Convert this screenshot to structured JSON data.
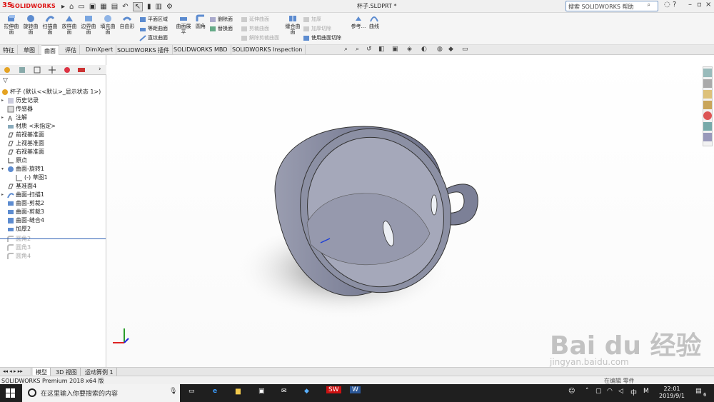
{
  "app": {
    "logo_text": "SOLIDWORKS",
    "doc_title": "杯子.SLDPRT *",
    "search_placeholder": "搜索 SOLIDWORKS 帮助"
  },
  "ribbon": {
    "buttons": [
      "拉伸曲面",
      "旋转曲面",
      "扫描曲面",
      "放样曲面",
      "边界曲面",
      "填充曲面",
      "自由形"
    ],
    "group1": [
      "平面区域",
      "等距曲面",
      "直纹曲面"
    ],
    "face_label": "曲面展平",
    "fillet_label": "圆角",
    "group2": [
      "删除面",
      "替换面"
    ],
    "group3": [
      "延伸曲面",
      "剪裁曲面",
      "解除剪裁曲面"
    ],
    "knit_label": "缝合曲面",
    "group4": [
      "加厚",
      "加厚切除",
      "使用曲面切除"
    ],
    "ref_label": "参考...",
    "curve_label": "曲线"
  },
  "tabs": [
    "特征",
    "草图",
    "曲面",
    "评估",
    "DimXpert",
    "SOLIDWORKS 插件",
    "SOLIDWORKS MBD",
    "SOLIDWORKS Inspection"
  ],
  "active_tab": "曲面",
  "tree": {
    "root": "杯子 (默认<<默认>_显示状态 1>)",
    "items": [
      "历史记录",
      "传感器",
      "注解",
      "材质 <未指定>",
      "前视基准面",
      "上视基准面",
      "右视基准面",
      "原点",
      "曲面-旋转1",
      "(-) 草图1",
      "基准面4",
      "曲面-扫描1",
      "曲面-剪裁2",
      "曲面-剪裁3",
      "曲面-缝合4",
      "加厚2",
      "圆角2",
      "圆角3",
      "圆角4"
    ]
  },
  "bottom_tabs": [
    "模型",
    "3D 视图",
    "运动算例 1"
  ],
  "status": {
    "left": "SOLIDWORKS Premium 2018 x64 版",
    "right": "在编辑 零件"
  },
  "taskbar": {
    "search_placeholder": "在这里输入你要搜索的内容",
    "ime": "中",
    "ime2": "M",
    "time": "22:01",
    "date": "2019/9/1",
    "notify_count": "6"
  },
  "watermark": {
    "text": "Bai du 经验",
    "url": "jingyan.baidu.com"
  },
  "colors": {
    "accent": "#d11a1a",
    "selection": "#2d5fb5",
    "model": "#8a8fa3"
  }
}
